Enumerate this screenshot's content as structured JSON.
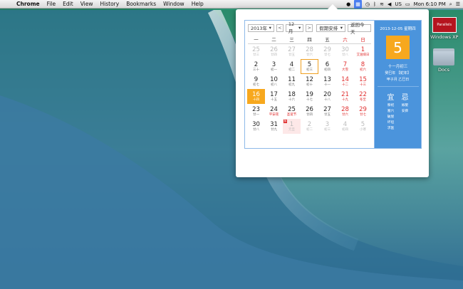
{
  "menubar": {
    "app_name": "Chrome",
    "menus": [
      "File",
      "Edit",
      "View",
      "History",
      "Bookmarks",
      "Window",
      "Help"
    ],
    "clock": "Mon 6:10 PM",
    "flag": "US"
  },
  "desktop": {
    "icons": [
      {
        "label": "Windows XP",
        "badge": "Parallels"
      },
      {
        "label": "Docs"
      }
    ]
  },
  "calendar": {
    "toolbar": {
      "year": "2013年",
      "month": "12月",
      "holiday_select": "假期安排",
      "today_button": "返回今天",
      "prev": "<",
      "next": ">"
    },
    "weekdays": [
      "一",
      "二",
      "三",
      "四",
      "五",
      "六",
      "日"
    ],
    "weeks": [
      [
        {
          "n": "25",
          "l": "廿三",
          "other": true
        },
        {
          "n": "26",
          "l": "廿四",
          "other": true
        },
        {
          "n": "27",
          "l": "廿五",
          "other": true
        },
        {
          "n": "28",
          "l": "廿六",
          "other": true
        },
        {
          "n": "29",
          "l": "廿七",
          "other": true
        },
        {
          "n": "30",
          "l": "廿八",
          "other": true
        },
        {
          "n": "1",
          "l": "艾滋病日",
          "red": true
        }
      ],
      [
        {
          "n": "2",
          "l": "三十"
        },
        {
          "n": "3",
          "l": "初一"
        },
        {
          "n": "4",
          "l": "初二"
        },
        {
          "n": "5",
          "l": "初三",
          "selected": true
        },
        {
          "n": "6",
          "l": "初四"
        },
        {
          "n": "7",
          "l": "大雪",
          "red": true
        },
        {
          "n": "8",
          "l": "初六",
          "red": true
        }
      ],
      [
        {
          "n": "9",
          "l": "初七"
        },
        {
          "n": "10",
          "l": "初八"
        },
        {
          "n": "11",
          "l": "初九"
        },
        {
          "n": "12",
          "l": "初十"
        },
        {
          "n": "13",
          "l": "十一"
        },
        {
          "n": "14",
          "l": "十二",
          "red": true
        },
        {
          "n": "15",
          "l": "十三",
          "red": true
        }
      ],
      [
        {
          "n": "16",
          "l": "十四",
          "today": true
        },
        {
          "n": "17",
          "l": "十五"
        },
        {
          "n": "18",
          "l": "十六"
        },
        {
          "n": "19",
          "l": "十七"
        },
        {
          "n": "20",
          "l": "十八"
        },
        {
          "n": "21",
          "l": "十九",
          "red": true
        },
        {
          "n": "22",
          "l": "冬至",
          "red": true
        }
      ],
      [
        {
          "n": "23",
          "l": "廿一"
        },
        {
          "n": "24",
          "l": "平安夜",
          "redlunar": true
        },
        {
          "n": "25",
          "l": "圣诞节",
          "redlunar": true
        },
        {
          "n": "26",
          "l": "廿四"
        },
        {
          "n": "27",
          "l": "廿五"
        },
        {
          "n": "28",
          "l": "廿六",
          "red": true
        },
        {
          "n": "29",
          "l": "廿七",
          "red": true
        }
      ],
      [
        {
          "n": "30",
          "l": "廿八"
        },
        {
          "n": "31",
          "l": "廿九"
        },
        {
          "n": "1",
          "l": "元旦",
          "other": true,
          "holiday": true,
          "badge": "休"
        },
        {
          "n": "2",
          "l": "初二",
          "other": true
        },
        {
          "n": "3",
          "l": "初三",
          "other": true
        },
        {
          "n": "4",
          "l": "初四",
          "other": true
        },
        {
          "n": "5",
          "l": "小寒",
          "other": true
        }
      ]
    ],
    "side": {
      "date_line": "2013-12-05 星期四",
      "big_day": "5",
      "lunar_date": "十一月初三",
      "ganzhi_1": "癸巳年 【蛇年】",
      "ganzhi_2": "甲子月 乙巳日",
      "yi_head": "宜",
      "ji_head": "忌",
      "yi_items": [
        "祭祀",
        "塞穴",
        "破屋",
        "坏垣",
        "求医"
      ],
      "ji_items": [
        "嫁娶",
        "安葬"
      ]
    }
  }
}
